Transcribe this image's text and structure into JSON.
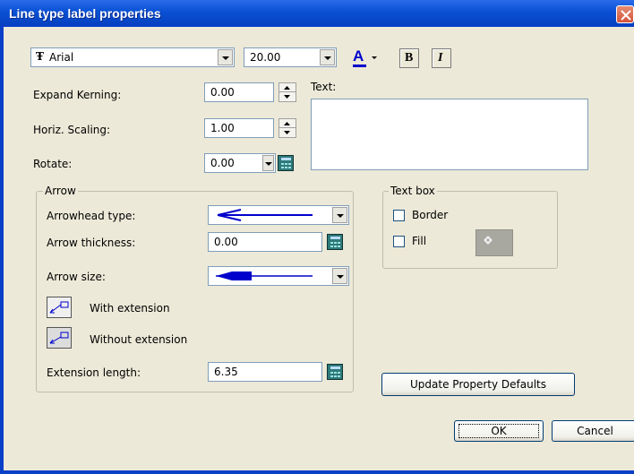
{
  "window": {
    "title": "Line type label properties"
  },
  "toolbar": {
    "font_name": "Arial",
    "font_size": "20.00",
    "font_color_letter": "A",
    "bold_label": "B",
    "italic_label": "I"
  },
  "fields": {
    "expand_kerning": {
      "label": "Expand Kerning:",
      "value": "0.00"
    },
    "horiz_scaling": {
      "label": "Horiz. Scaling:",
      "value": "1.00"
    },
    "rotate": {
      "label": "Rotate:",
      "value": "0.00"
    },
    "text": {
      "label": "Text:",
      "value": ""
    }
  },
  "arrow": {
    "group_label": "Arrow",
    "arrowhead_type_label": "Arrowhead type:",
    "arrow_thickness_label": "Arrow thickness:",
    "arrow_thickness_value": "0.00",
    "arrow_size_label": "Arrow size:",
    "with_extension_label": "With extension",
    "without_extension_label": "Without extension",
    "extension_length_label": "Extension length:",
    "extension_length_value": "6.35"
  },
  "textbox": {
    "group_label": "Text box",
    "border_label": "Border",
    "border_checked": false,
    "fill_label": "Fill",
    "fill_checked": false
  },
  "buttons": {
    "update_defaults": "Update Property Defaults",
    "ok": "OK",
    "cancel": "Cancel"
  },
  "colors": {
    "titlebar": "#0A52D6",
    "dialog_bg": "#ECE9D8",
    "arrow_blue": "#0000CC",
    "font_color_underline": "#0000CC"
  }
}
